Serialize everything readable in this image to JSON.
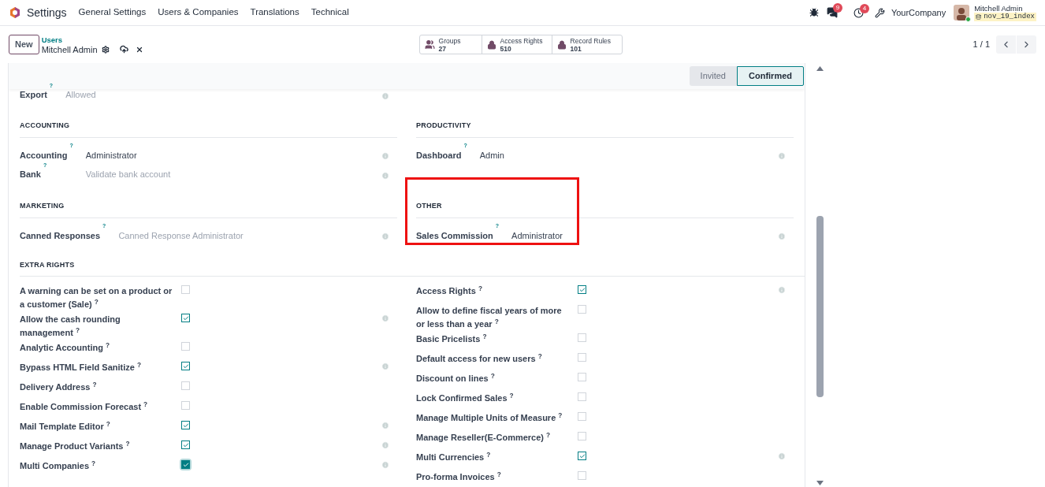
{
  "navbar": {
    "app_name": "Settings",
    "menus": [
      "General Settings",
      "Users & Companies",
      "Translations",
      "Technical"
    ],
    "chat_badge": "9",
    "activity_badge": "4",
    "company": "YourCompany",
    "user": "Mitchell Admin",
    "database": "nov_19_index"
  },
  "control_panel": {
    "new_button": "New",
    "breadcrumb": "Users",
    "record": "Mitchell Admin",
    "smart_buttons": [
      {
        "kind": "users",
        "label": "Groups",
        "value": "27"
      },
      {
        "kind": "lock",
        "label": "Access Rights",
        "value": "510"
      },
      {
        "kind": "lock",
        "label": "Record Rules",
        "value": "101"
      }
    ],
    "pager": "1 / 1"
  },
  "status_bar": [
    {
      "label": "Invited",
      "selected": false
    },
    {
      "label": "Confirmed",
      "selected": true
    }
  ],
  "top_field": {
    "label": "Export",
    "help": "?",
    "value": "Allowed",
    "muted": true,
    "info": true
  },
  "section_rows": [
    [
      {
        "title": "ACCOUNTING",
        "highlight": false,
        "fields": [
          {
            "label": "Accounting",
            "help": "?",
            "value": "Administrator",
            "muted": false,
            "info": true
          },
          {
            "label": "Bank",
            "help": "?",
            "value": "Validate bank account",
            "muted": true,
            "info": true
          }
        ]
      },
      {
        "title": "PRODUCTIVITY",
        "highlight": false,
        "fields": [
          {
            "label": "Dashboard",
            "help": "?",
            "value": "Admin",
            "muted": false,
            "info": true
          }
        ]
      }
    ],
    [
      {
        "title": "MARKETING",
        "highlight": false,
        "fields": [
          {
            "label": "Canned Responses",
            "help": "?",
            "value": "Canned Response Administrator",
            "muted": true,
            "info": true
          }
        ]
      },
      {
        "title": "OTHER",
        "highlight": true,
        "fields": [
          {
            "label": "Sales Commission",
            "help": "?",
            "value": "Administrator",
            "muted": false,
            "info": true
          }
        ]
      }
    ]
  ],
  "extra_rights": {
    "title": "EXTRA RIGHTS",
    "columns": [
      [
        {
          "label": "A warning can be set on a product or a customer (Sale)",
          "help": "?",
          "checked": false,
          "focused": false,
          "info": false
        },
        {
          "label": "Allow the cash rounding management",
          "help": "?",
          "checked": true,
          "focused": false,
          "info": true
        },
        {
          "label": "Analytic Accounting",
          "help": "?",
          "checked": false,
          "focused": false,
          "info": false
        },
        {
          "label": "Bypass HTML Field Sanitize",
          "help": "?",
          "checked": true,
          "focused": false,
          "info": true
        },
        {
          "label": "Delivery Address",
          "help": "?",
          "checked": false,
          "focused": false,
          "info": false
        },
        {
          "label": "Enable Commission Forecast",
          "help": "?",
          "checked": false,
          "focused": false,
          "info": false
        },
        {
          "label": "Mail Template Editor",
          "help": "?",
          "checked": true,
          "focused": false,
          "info": true
        },
        {
          "label": "Manage Product Variants",
          "help": "?",
          "checked": true,
          "focused": false,
          "info": true
        },
        {
          "label": "Multi Companies",
          "help": "?",
          "checked": true,
          "focused": true,
          "info": true
        }
      ],
      [
        {
          "label": "Access Rights",
          "help": "?",
          "checked": true,
          "focused": false,
          "info": true
        },
        {
          "label": "Allow to define fiscal years of more or less than a year",
          "help": "?",
          "checked": false,
          "focused": false,
          "info": false
        },
        {
          "label": "Basic Pricelists",
          "help": "?",
          "checked": false,
          "focused": false,
          "info": false
        },
        {
          "label": "Default access for new users",
          "help": "?",
          "checked": false,
          "focused": false,
          "info": false
        },
        {
          "label": "Discount on lines",
          "help": "?",
          "checked": false,
          "focused": false,
          "info": false
        },
        {
          "label": "Lock Confirmed Sales",
          "help": "?",
          "checked": false,
          "focused": false,
          "info": false
        },
        {
          "label": "Manage Multiple Units of Measure",
          "help": "?",
          "checked": false,
          "focused": false,
          "info": false
        },
        {
          "label": "Manage Reseller(E-Commerce)",
          "help": "?",
          "checked": false,
          "focused": false,
          "info": false
        },
        {
          "label": "Multi Currencies",
          "help": "?",
          "checked": true,
          "focused": false,
          "info": true
        },
        {
          "label": "Pro-forma Invoices",
          "help": "?",
          "checked": false,
          "focused": false,
          "info": false
        }
      ]
    ]
  }
}
